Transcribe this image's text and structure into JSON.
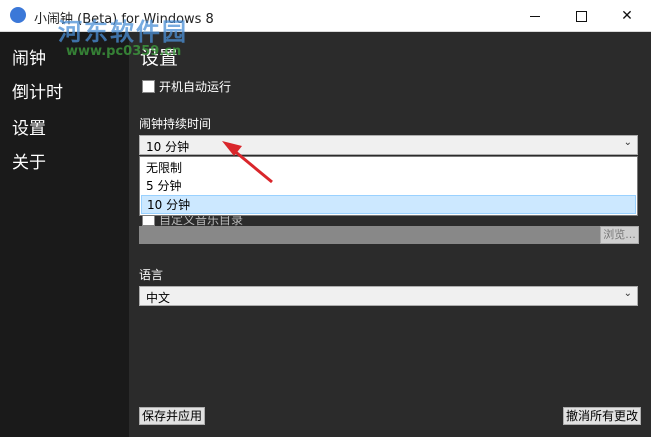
{
  "window": {
    "title": "小闹钟 (Beta) for Windows 8",
    "watermark_text": "河东软件园",
    "watermark_url": "www.pc0359.cn"
  },
  "sidebar": {
    "items": [
      {
        "label": "闹钟"
      },
      {
        "label": "倒计时"
      },
      {
        "label": "设置"
      },
      {
        "label": "关于"
      }
    ]
  },
  "settings": {
    "title": "设置",
    "autostart_label": "开机自动运行",
    "duration_label": "闹钟持续时间",
    "duration_selected": "10 分钟",
    "duration_options": [
      "无限制",
      "5 分钟",
      "10 分钟"
    ],
    "custom_music_label": "自定义音乐目录",
    "browse_label": "浏览...",
    "language_label": "语言",
    "language_selected": "中文",
    "save_label": "保存并应用",
    "revert_label": "撤消所有更改"
  },
  "colors": {
    "sidebar_bg": "#1a1a1a",
    "content_bg": "#2b2b2b",
    "selection": "#cce8ff",
    "annotation_arrow": "#d9262b"
  },
  "icons": {
    "app": "alarm-clock-icon",
    "minimize": "minimize-icon",
    "maximize": "maximize-icon",
    "close": "close-icon",
    "chevron": "chevron-down-icon"
  }
}
